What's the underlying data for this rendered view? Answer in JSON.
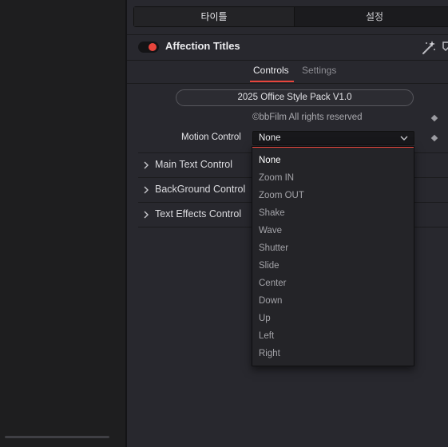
{
  "top_tabs": [
    "타이틀",
    "설정"
  ],
  "tool": {
    "title": "Affection Titles",
    "enabled": true,
    "accent_color": "#e8453c"
  },
  "sub_tabs": {
    "controls": "Controls",
    "settings": "Settings",
    "active": "Controls"
  },
  "pack_button": "2025 Office Style Pack V1.0",
  "copyright": "©bbFilm All rights reserved",
  "motion_control": {
    "label": "Motion Control",
    "value": "None"
  },
  "groups": [
    "Main Text Control",
    "BackGround Control",
    "Text Effects Control"
  ],
  "menu": {
    "selected": "None",
    "options": [
      "None",
      "Zoom IN",
      "Zoom OUT",
      "Shake",
      "Wave",
      "Shutter",
      "Slide",
      "Center",
      "Down",
      "Up",
      "Left",
      "Right"
    ]
  },
  "icons": {
    "toggle": "toggle-switch-icon",
    "wand": "magic-wand-icon",
    "keyframe": "keyframe-diamond-icon",
    "chevron": "chevron-down-icon",
    "expand": "chevron-right-icon"
  }
}
